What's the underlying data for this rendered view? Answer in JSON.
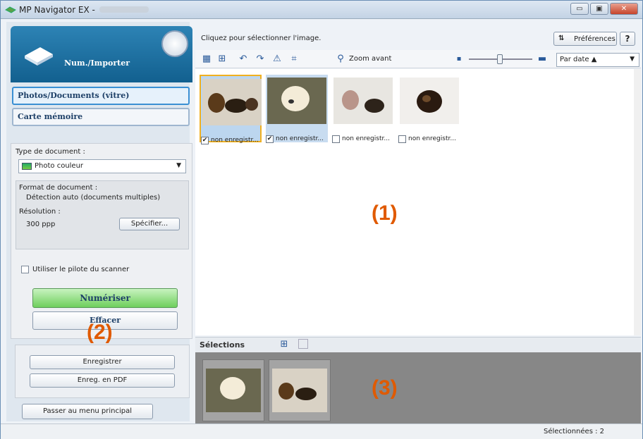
{
  "window": {
    "title": "MP Navigator EX -",
    "min_label": "▭",
    "max_label": "▣",
    "close_label": "✕"
  },
  "left": {
    "header_label": "Num./Importer",
    "nav": [
      "Photos/Documents (vitre)",
      "Carte mémoire"
    ],
    "doc_type_label": "Type de document :",
    "doc_type_value": "Photo couleur",
    "format_label": "Format de document :",
    "format_value": "Détection auto (documents multiples)",
    "resolution_label": "Résolution :",
    "resolution_value": "300 ppp",
    "specify_label": "Spécifier...",
    "driver_label": "Utiliser le pilote du scanner",
    "scan_label": "Numériser",
    "clear_label": "Effacer",
    "save_label": "Enregistrer",
    "save_pdf_label": "Enreg. en PDF",
    "main_menu_label": "Passer au menu principal"
  },
  "right": {
    "hint": "Cliquez pour sélectionner l'image.",
    "pref_label": "Préférences",
    "help_label": "?",
    "zoom_label": "Zoom avant",
    "sort_value": "Par date ▲",
    "thumbnails": [
      {
        "caption": "non enregistr...",
        "checked": true
      },
      {
        "caption": "non enregistr...",
        "checked": true
      },
      {
        "caption": "non enregistr...",
        "checked": false
      },
      {
        "caption": "non enregistr...",
        "checked": false
      }
    ],
    "selections_label": "Sélections",
    "status": "Sélectionnées : 2"
  },
  "annotations": {
    "one": "(1)",
    "two": "(2)",
    "three": "(3)"
  }
}
